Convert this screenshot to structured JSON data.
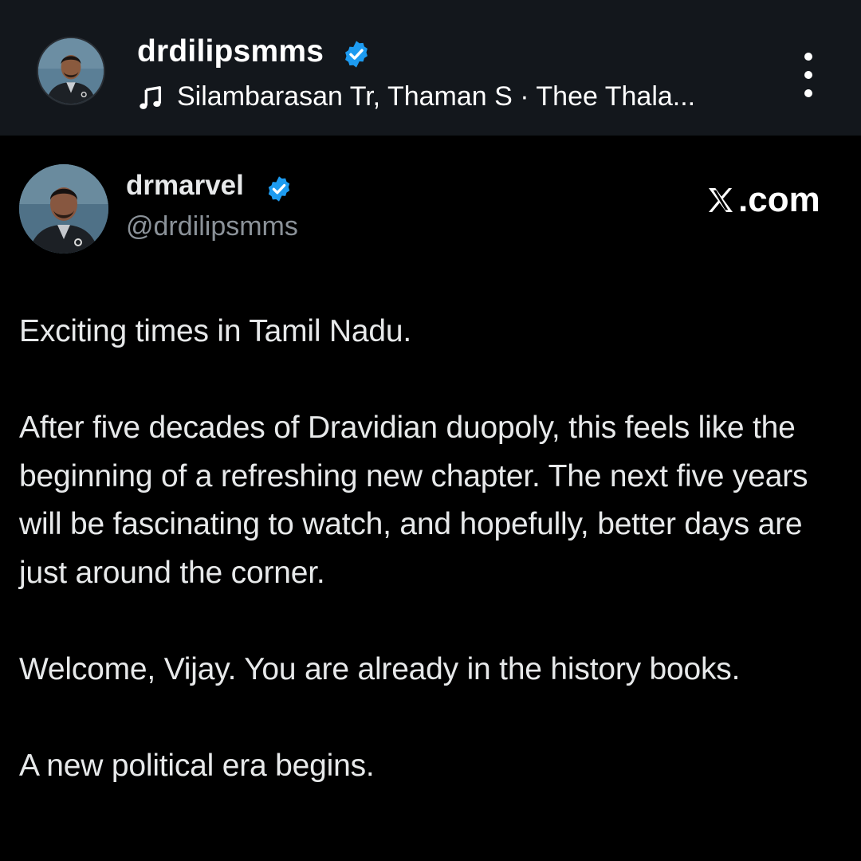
{
  "post_header": {
    "username": "drdilipsmms",
    "music": "Silambarasan Tr, Thaman S · Thee Thala..."
  },
  "tweet": {
    "display_name": "drmarvel",
    "handle": "@drdilipsmms",
    "source_label": ".com",
    "paragraphs": [
      "Exciting times in Tamil Nadu.",
      "After five decades of Dravidian duopoly, this feels like the beginning of a refreshing new chapter. The next five years will be fascinating to watch, and hopefully, better days are just around the corner.",
      "Welcome, Vijay. You are already in the history books.",
      "A new political era begins."
    ]
  },
  "icons": {
    "verified": "verified-badge-icon",
    "music": "music-note-icon",
    "more": "more-vertical-icon",
    "x_logo": "x-logo-icon"
  },
  "colors": {
    "header_bg": "#13171c",
    "page_bg": "#000000",
    "verified_blue": "#1d9bf0",
    "handle_gray": "#8b9299",
    "text": "#e7e9ea"
  }
}
